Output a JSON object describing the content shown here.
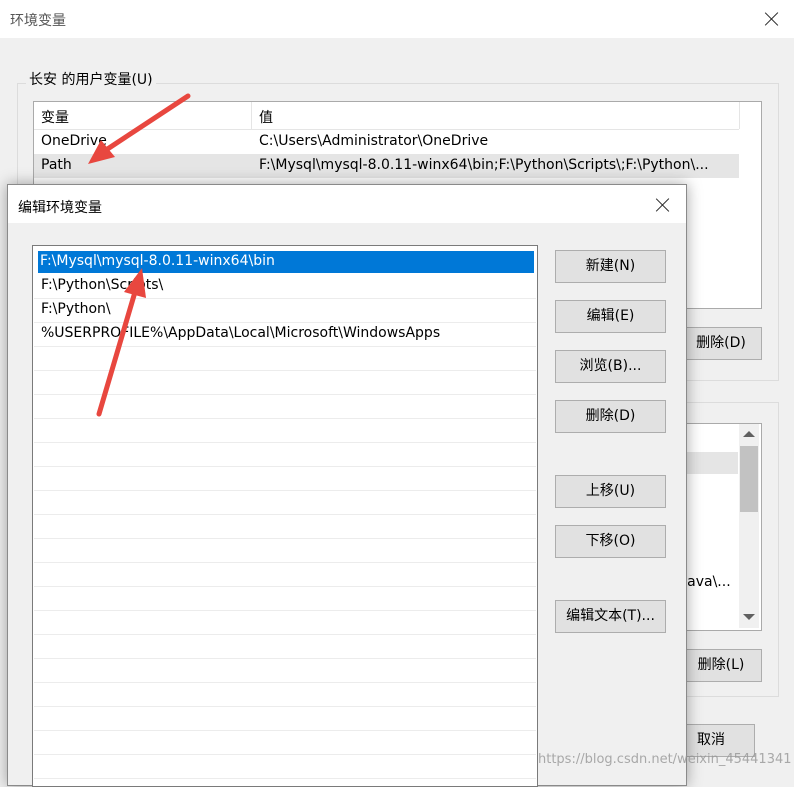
{
  "bg_window": {
    "title": "环境变量",
    "user_group_label": "长安 的用户变量(U)",
    "col_variable": "变量",
    "col_value": "值",
    "rows": [
      {
        "name": "OneDrive",
        "value": "C:\\Users\\Administrator\\OneDrive"
      },
      {
        "name": "Path",
        "value": "F:\\Mysql\\mysql-8.0.11-winx64\\bin;F:\\Python\\Scripts\\;F:\\Python\\..."
      }
    ],
    "user_delete_label": "删除(D)",
    "sys_delete_label": "删除(L)",
    "cancel_label": "取消",
    "sys_partial_value": "Java\\..."
  },
  "dialog": {
    "title": "编辑环境变量",
    "paths": [
      "F:\\Mysql\\mysql-8.0.11-winx64\\bin",
      "F:\\Python\\Scripts\\",
      "F:\\Python\\",
      "%USERPROFILE%\\AppData\\Local\\Microsoft\\WindowsApps"
    ],
    "buttons": {
      "new": "新建(N)",
      "edit": "编辑(E)",
      "browse": "浏览(B)...",
      "delete": "删除(D)",
      "move_up": "上移(U)",
      "move_down": "下移(O)",
      "edit_text": "编辑文本(T)..."
    }
  },
  "watermark": "https://blog.csdn.net/weixin_45441341",
  "annotation_color": "#e8473f",
  "selection_color": "#0078d7"
}
